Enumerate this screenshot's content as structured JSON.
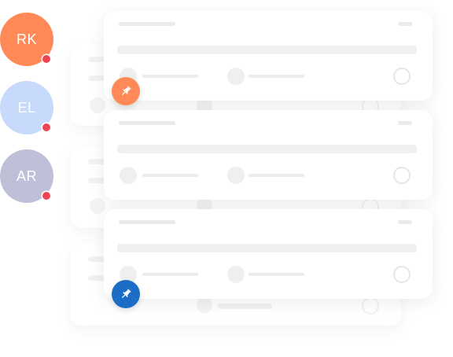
{
  "avatars": [
    {
      "initials": "RK",
      "color": "#FF8A57",
      "status_color": "#EE4554",
      "has_notification": true
    },
    {
      "initials": "EL",
      "color": "#C8DAFB",
      "status_color": "#EE4554",
      "has_notification": true
    },
    {
      "initials": "AR",
      "color": "#BFC0D8",
      "status_color": "#EE4554",
      "has_notification": true
    }
  ],
  "cards": [
    {
      "pinned": true,
      "pin_color": "#FF8A57",
      "pin_icon": "pushpin-icon"
    },
    {
      "pinned": false
    },
    {
      "pinned": true,
      "pin_color": "#1C6DC6",
      "pin_icon": "pushpin-icon"
    }
  ],
  "colors": {
    "placeholder": "#EEEEEE",
    "card_background": "#FFFFFF"
  }
}
